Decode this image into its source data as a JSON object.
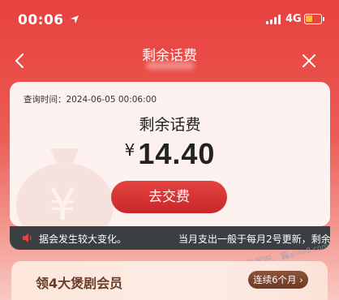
{
  "status_bar": {
    "time": "00:06",
    "network": "4G"
  },
  "header": {
    "title": "剩余话费",
    "back_icon": "chevron-left-icon",
    "close_icon": "close-icon"
  },
  "card": {
    "query_time": "查询时间：2024-06-05 00:06:00",
    "balance_title": "剩余话费",
    "currency": "¥",
    "amount": "14.40",
    "pay_button": "去交费"
  },
  "notice": {
    "text_1": "据会发生较大变化。",
    "text_2": "当月支出一般于每月2号更新，剩余"
  },
  "promo": {
    "title": "领4大煲剧会员",
    "button": "连续6个月 ›"
  },
  "watermark": {
    "part_1": "赚客吧，有",
    "part_2": "zuanke8.com"
  },
  "colors": {
    "primary_red": "#e6423f",
    "notice_bg": "#3b3e42",
    "battery_yellow": "#f5c033"
  }
}
